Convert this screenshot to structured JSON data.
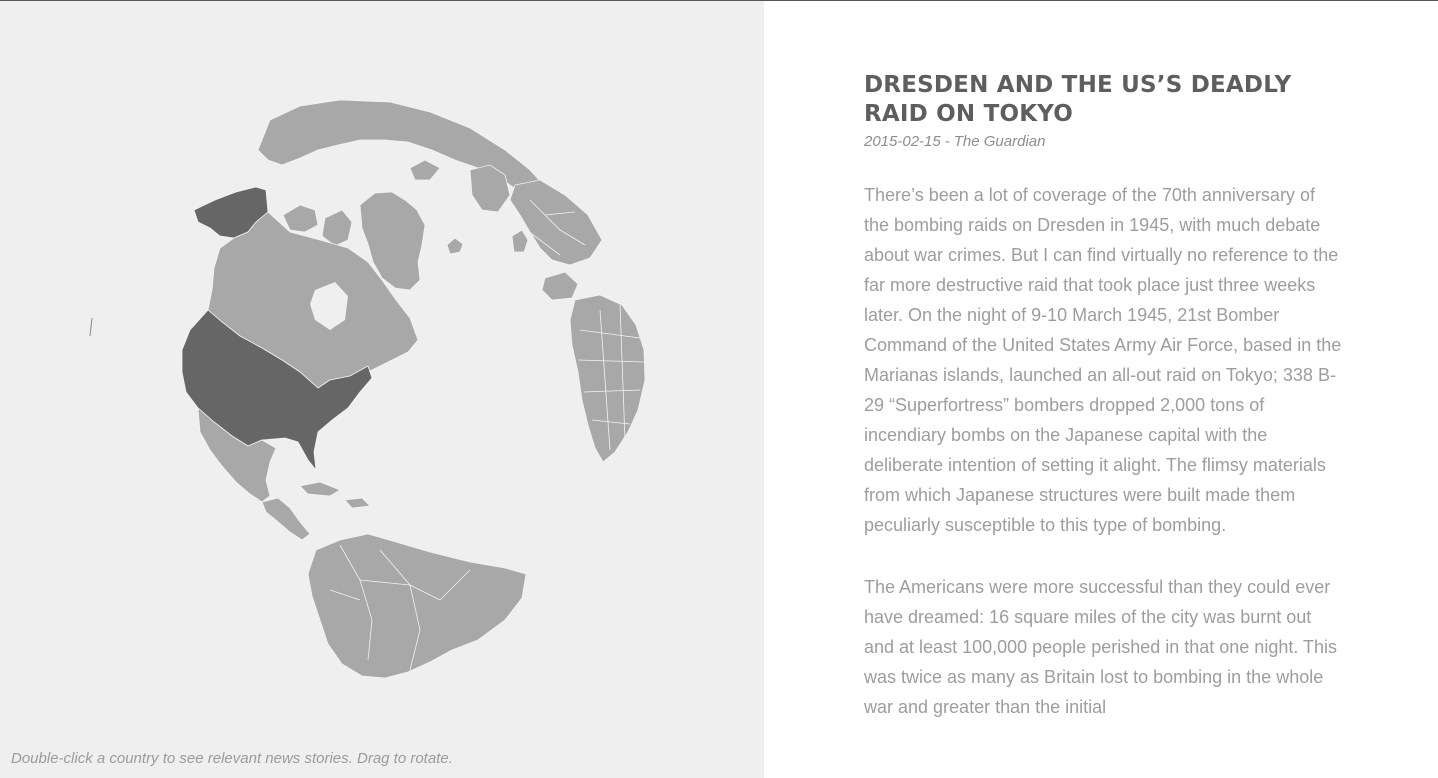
{
  "map": {
    "hint_text": "Double-click a country to see relevant news stories. Drag to rotate.",
    "ocean_color": "#efefef",
    "land_color": "#a8a8a8",
    "highlight_color": "#666666",
    "border_color": "#f2f2f2",
    "highlighted_countries": [
      "United States of America"
    ]
  },
  "article": {
    "title": "DRESDEN AND THE US’S DEADLY RAID ON TOKYO",
    "date": "2015-02-15",
    "separator": "-",
    "source": "The Guardian",
    "paragraphs": [
      "There’s been a lot of coverage of the 70th anniversary of the bombing raids on Dresden in 1945, with much debate about war crimes. But I can find virtually no reference to the far more destructive raid that took place just three weeks later. On the night of 9-10 March 1945, 21st Bomber Command of the United States Army Air Force, based in the Marianas islands, launched an all-out raid on Tokyo; 338 B-29 “Superfortress” bombers dropped 2,000 tons of incendiary bombs on the Japanese capital with the deliberate intention of setting it alight. The flimsy materials from which Japanese structures were built made them peculiarly susceptible to this type of bombing.",
      "The Americans were more successful than they could ever have dreamed: 16 square miles of the city was burnt out and at least 100,000 people perished in that one night. This was twice as many as Britain lost to bombing in the whole war and greater than the initial"
    ]
  }
}
